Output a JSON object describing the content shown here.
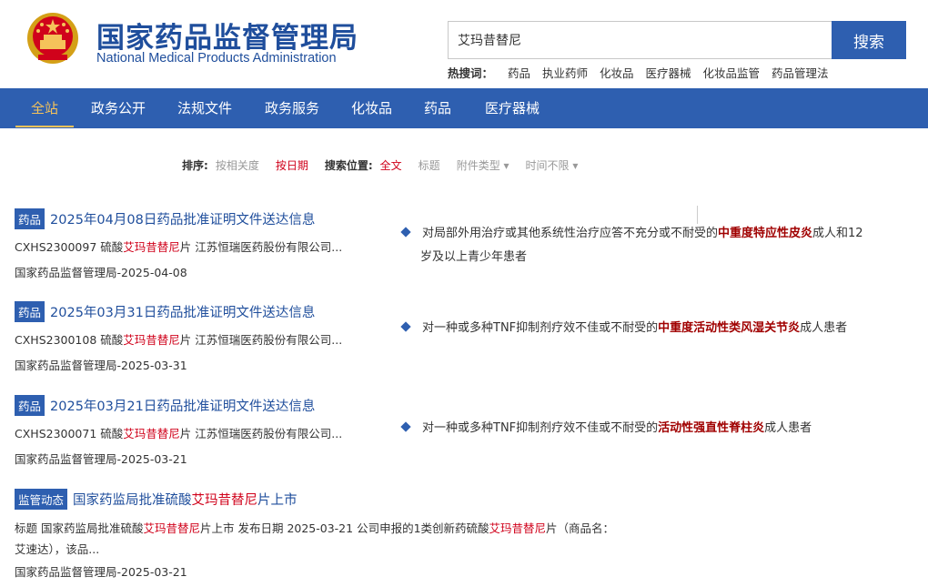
{
  "header": {
    "title_cn": "国家药品监督管理局",
    "title_en": "National Medical Products Administration",
    "emblem_icon": "national-emblem-icon"
  },
  "search": {
    "value": "艾玛昔替尼",
    "button_label": "搜索",
    "hot_label": "热搜词：",
    "hot_words": [
      "药品",
      "执业药师",
      "化妆品",
      "医疗器械",
      "化妆品监管",
      "药品管理法"
    ]
  },
  "nav": {
    "items": [
      "全站",
      "政务公开",
      "法规文件",
      "政务服务",
      "化妆品",
      "药品",
      "医疗器械"
    ],
    "active_index": 0
  },
  "filter": {
    "sort_label": "排序:",
    "sort_relevance": "按相关度",
    "sort_date": "按日期",
    "position_label": "搜索位置:",
    "pos_full": "全文",
    "pos_title": "标题",
    "attachment": "附件类型 ▾",
    "time": "时间不限 ▾"
  },
  "results": [
    {
      "tag": "药品",
      "title": "2025年04月08日药品批准证明文件送达信息",
      "line_pre": "CXHS2300097 硫酸",
      "line_hl": "艾玛昔替尼",
      "line_post": "片 江苏恒瑞医药股份有限公司...",
      "source": "国家药品监督管理局-2025-04-08"
    },
    {
      "tag": "药品",
      "title": "2025年03月31日药品批准证明文件送达信息",
      "line_pre": "CXHS2300108 硫酸",
      "line_hl": "艾玛昔替尼",
      "line_post": "片 江苏恒瑞医药股份有限公司...",
      "source": "国家药品监督管理局-2025-03-31"
    },
    {
      "tag": "药品",
      "title": "2025年03月21日药品批准证明文件送达信息",
      "line_pre": "CXHS2300071 硫酸",
      "line_hl": "艾玛昔替尼",
      "line_post": "片 江苏恒瑞医药股份有限公司...",
      "source": "国家药品监督管理局-2025-03-21"
    }
  ],
  "news": {
    "tag": "监管动态",
    "title_pre": "国家药监局批准硫酸",
    "title_hl": "艾玛昔替尼",
    "title_post": "片上市",
    "desc_1": "标题 国家药监局批准硫酸",
    "desc_hl1": "艾玛昔替尼",
    "desc_2": "片上市 发布日期 2025-03-21 公司申报的1类创新药硫酸",
    "desc_hl2": "艾玛昔替尼",
    "desc_3": "片（商品名：",
    "desc_4": "艾速达），该品...",
    "source": "国家药品监督管理局-2025-03-21"
  },
  "indications": [
    {
      "pre": "对局部外用治疗或其他系统性治疗应答不充分或不耐受的",
      "hl": "中重度特应性皮炎",
      "post": "成人和12",
      "post2": "岁及以上青少年患者"
    },
    {
      "pre": "对一种或多种TNF抑制剂疗效不佳或不耐受的",
      "hl": "中重度活动性类风湿关节炎",
      "post": "成人患者"
    },
    {
      "pre": "对一种或多种TNF抑制剂疗效不佳或不耐受的",
      "hl": "活动性强直性脊柱炎",
      "post": "成人患者"
    }
  ],
  "colors": {
    "brand_blue": "#2e5fb0",
    "title_blue": "#1f4e9c",
    "highlight_red": "#d0021b",
    "nav_active": "#f5c35a"
  }
}
